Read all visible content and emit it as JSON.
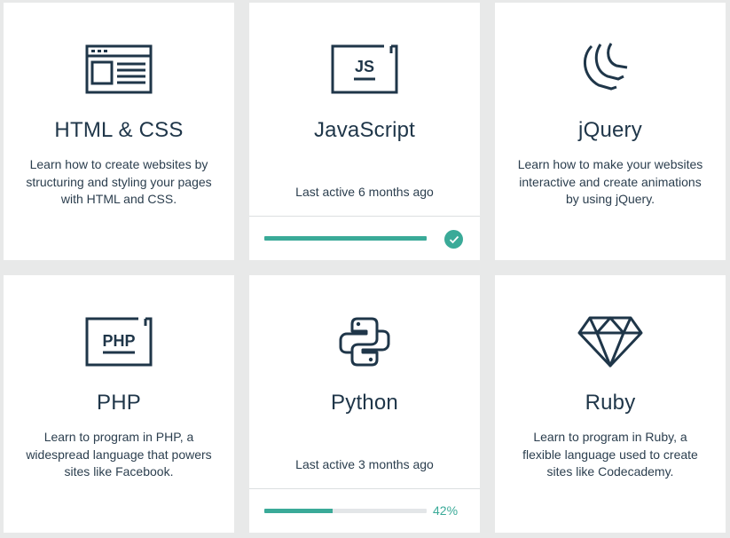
{
  "colors": {
    "background": "#e8e9e9",
    "card": "#ffffff",
    "text": "#1f3649",
    "accent": "#3aaa98",
    "track": "#e3e6e8"
  },
  "courses": [
    {
      "title": "HTML & CSS",
      "icon": "browser-window-icon",
      "description": "Learn how to create websites by structuring and styling your pages with HTML and CSS."
    },
    {
      "title": "JavaScript",
      "icon": "js-badge-icon",
      "last_active": "Last active 6 months ago",
      "progress": 1.0,
      "completed": true
    },
    {
      "title": "jQuery",
      "icon": "jquery-wave-icon",
      "description": "Learn how to make your websites interactive and create animations by using jQuery."
    },
    {
      "title": "PHP",
      "icon": "php-badge-icon",
      "badge_text": "PHP",
      "description": "Learn to program in PHP, a widespread language that powers sites like Facebook."
    },
    {
      "title": "Python",
      "icon": "python-logo-icon",
      "last_active": "Last active 3 months ago",
      "progress": 0.42,
      "progress_label": "42%"
    },
    {
      "title": "Ruby",
      "icon": "ruby-gem-icon",
      "description": "Learn to program in Ruby, a flexible language used to create sites like Codecademy."
    }
  ]
}
